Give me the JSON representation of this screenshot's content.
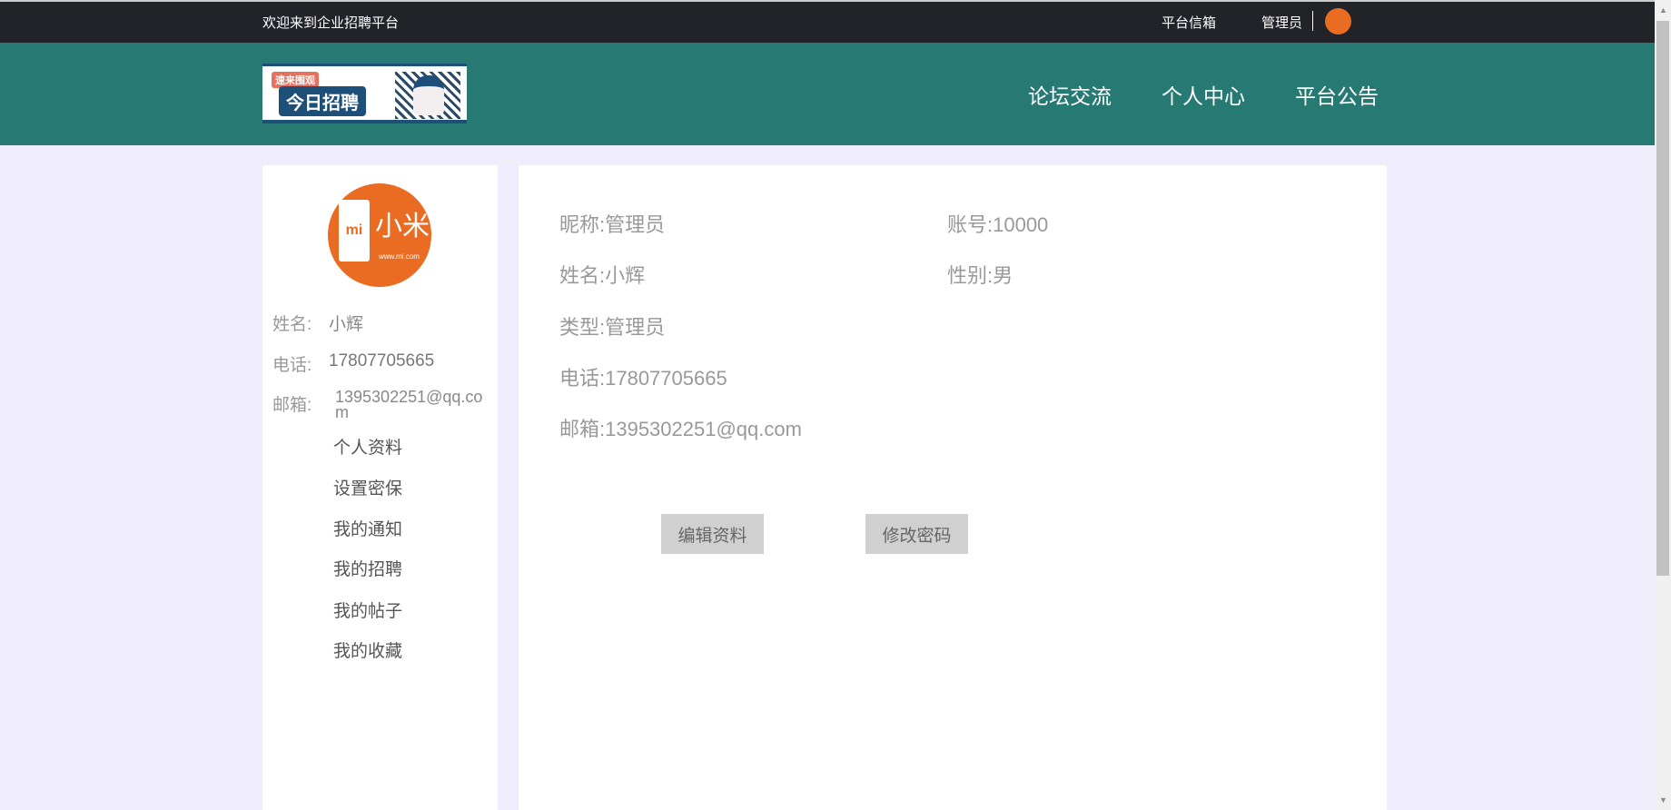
{
  "topbar": {
    "welcome": "欢迎来到企业招聘平台",
    "mailbox": "平台信箱",
    "user": "管理员"
  },
  "logo": {
    "tag": "速来围观",
    "title": "今日招聘"
  },
  "nav": [
    "论坛交流",
    "个人中心",
    "平台公告"
  ],
  "sidebar": {
    "avatar_text": "小米",
    "avatar_mark": "mi",
    "avatar_url": "www.mi.com",
    "name_label": "姓名:",
    "name": "小辉",
    "phone_label": "电话:",
    "phone": "17807705665",
    "email_label": "邮箱:",
    "email": "1395302251@qq.com",
    "menu": [
      "个人资料",
      "设置密保",
      "我的通知",
      "我的招聘",
      "我的帖子",
      "我的收藏"
    ]
  },
  "profile": {
    "nickname": "昵称:管理员",
    "account": "账号:10000",
    "name": "姓名:小辉",
    "gender": "性别:男",
    "type": "类型:管理员",
    "phone": "电话:17807705665",
    "email": "邮箱:1395302251@qq.com"
  },
  "buttons": {
    "edit": "编辑资料",
    "change_password": "修改密码"
  },
  "colors": {
    "topbar": "#212329",
    "header": "#277974",
    "background": "#efedfc",
    "avatar": "#ea6b22"
  }
}
